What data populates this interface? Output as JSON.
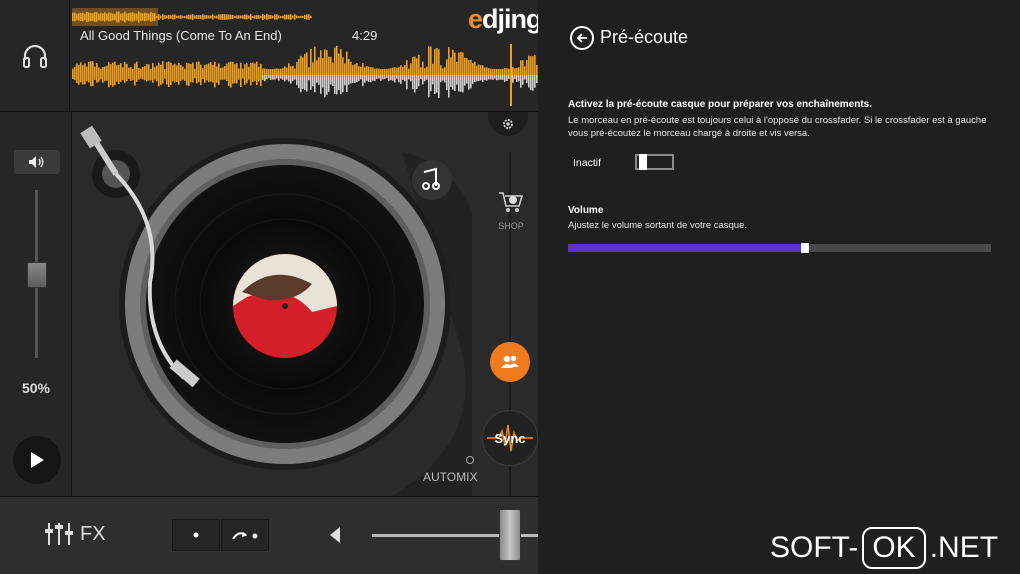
{
  "app": {
    "logo_text": "edjing",
    "colors": {
      "accent_orange": "#f08a24",
      "volume_purple": "#5b34c7",
      "wave_orange": "#f0a020"
    }
  },
  "deck": {
    "track_title": "All Good Things (Come To An End)",
    "track_time": "4:29",
    "volume_label": "50%",
    "volume_fraction": 0.5,
    "shop_label": "SHOP",
    "sync_label": "Sync",
    "automix_label": "AUTOMIX",
    "fx_label": "FX",
    "icons": {
      "headphone": "headphone-icon",
      "speaker": "speaker-icon",
      "play": "play-icon",
      "settings": "gear-icon",
      "shop": "cart-icon",
      "people": "people-icon",
      "music": "music-note-icon"
    }
  },
  "settings": {
    "title": "Pré-écoute",
    "preview_heading": "Activez la pré-écoute casque pour préparer vos enchaînements.",
    "preview_description": "Le morceau en pré-écoute est toujours celui à l'opposé du crossfader. Si le crossfader est à gauche vous pré-écoutez le morceau chargé à droite et vis versa.",
    "toggle_label": "Inactif",
    "toggle_on": false,
    "volume_heading": "Volume",
    "volume_description": "Ajustez le volume sortant de votre casque.",
    "volume_value": 0.56
  },
  "watermark": {
    "left": "SOFT-",
    "box": "OK",
    "right": ".NET"
  }
}
